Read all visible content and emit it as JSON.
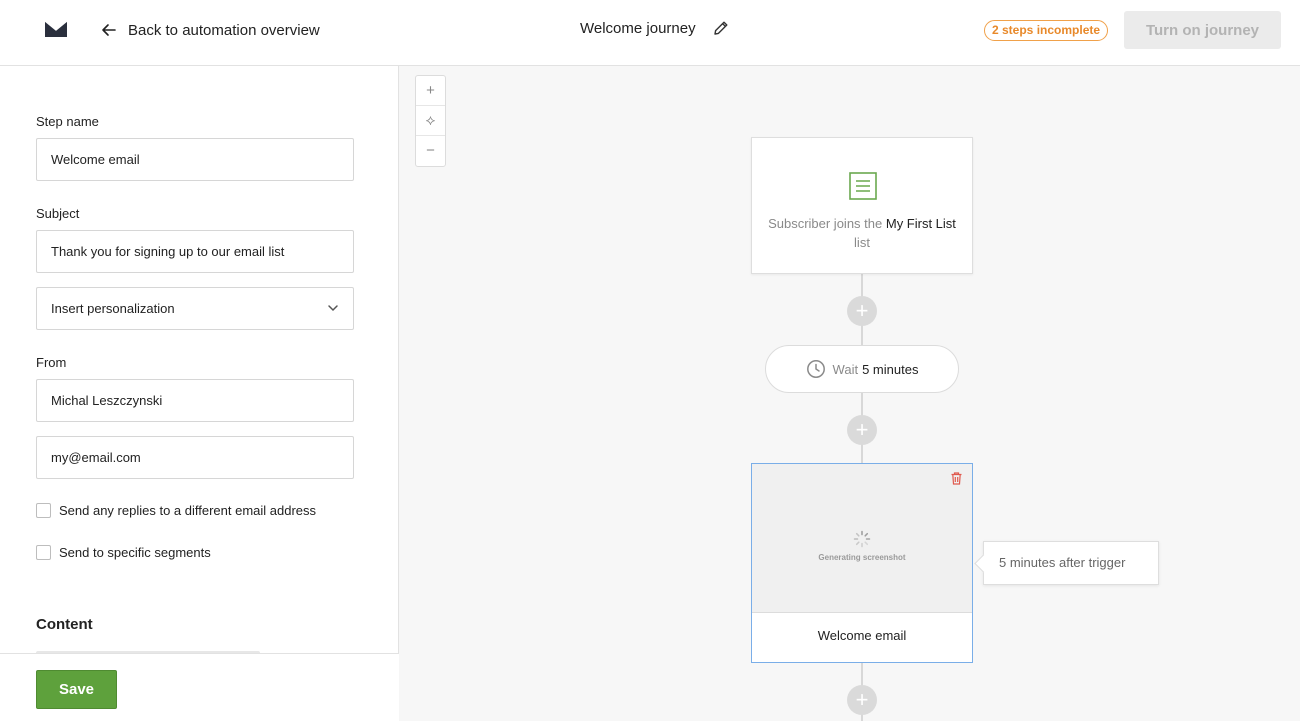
{
  "header": {
    "back_label": "Back to automation overview",
    "journey_title": "Welcome journey",
    "incomplete_badge": "2 steps incomplete",
    "turn_on_label": "Turn on journey"
  },
  "form": {
    "step_name_label": "Step name",
    "step_name_value": "Welcome email",
    "subject_label": "Subject",
    "subject_value": "Thank you for signing up to our email list",
    "personalization_select": "Insert personalization",
    "from_label": "From",
    "from_name_value": "Michal Leszczynski",
    "from_email_value": "my@email.com",
    "checkbox_replies": "Send any replies to a different email address",
    "checkbox_segments": "Send to specific segments",
    "content_heading": "Content",
    "save_label": "Save"
  },
  "canvas": {
    "zoom_in": "+",
    "zoom_center": "⟡",
    "zoom_out": "−",
    "trigger": {
      "prefix": "Subscriber joins the",
      "list_name": "My First List",
      "suffix": "list"
    },
    "wait": {
      "prefix": "Wait",
      "value": "5 minutes"
    },
    "email_step": {
      "preview_text": "Generating screenshot",
      "title": "Welcome email"
    },
    "tooltip": "5 minutes after trigger",
    "add_symbol": "+"
  },
  "colors": {
    "save_green": "#5ea13c",
    "badge_orange": "#e8892a",
    "selected_blue": "#7aaee8",
    "trash_red": "#e0594d"
  }
}
